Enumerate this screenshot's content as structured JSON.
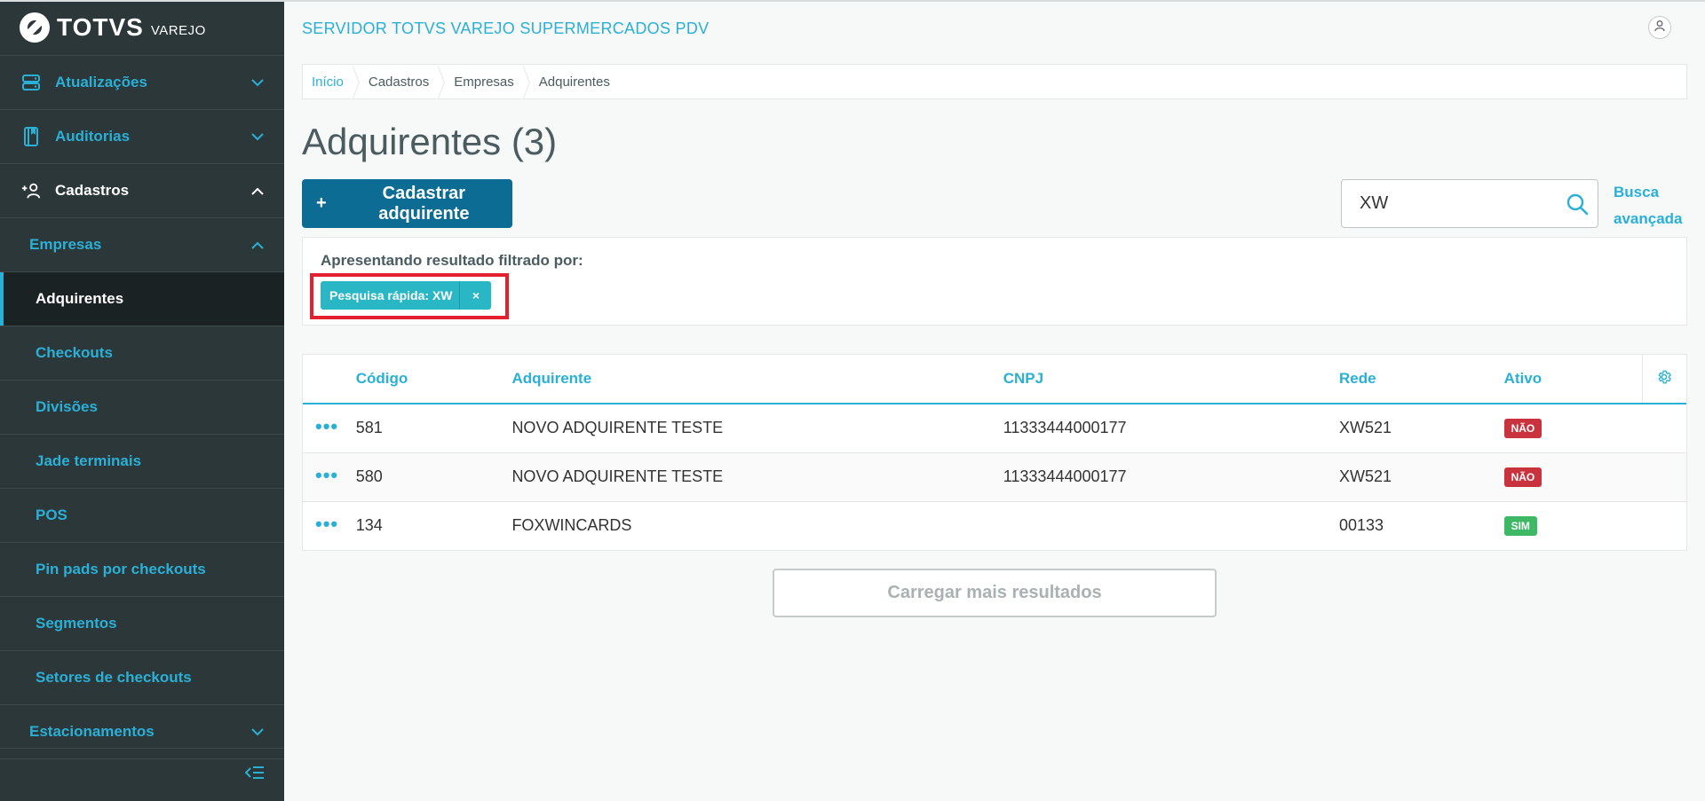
{
  "brand": {
    "name": "TOTVS",
    "sub": "VAREJO"
  },
  "sidebar": {
    "items": [
      {
        "label": "Atualizações",
        "icon": "server-icon",
        "level": 1,
        "state": "collapsed"
      },
      {
        "label": "Auditorias",
        "icon": "book-icon",
        "level": 1,
        "state": "collapsed"
      },
      {
        "label": "Cadastros",
        "icon": "add-user-icon",
        "level": 1,
        "state": "expanded"
      },
      {
        "label": "Empresas",
        "level": 2,
        "state": "expanded"
      },
      {
        "label": "Adquirentes",
        "level": 3,
        "active": true
      },
      {
        "label": "Checkouts",
        "level": 3
      },
      {
        "label": "Divisões",
        "level": 3
      },
      {
        "label": "Jade terminais",
        "level": 3
      },
      {
        "label": "POS",
        "level": 3
      },
      {
        "label": "Pin pads por checkouts",
        "level": 3
      },
      {
        "label": "Segmentos",
        "level": 3
      },
      {
        "label": "Setores de checkouts",
        "level": 3
      },
      {
        "label": "Estacionamentos",
        "level": 2,
        "state": "collapsed"
      }
    ]
  },
  "header": {
    "app_title": "SERVIDOR TOTVS VAREJO SUPERMERCADOS PDV"
  },
  "breadcrumb": [
    "Início",
    "Cadastros",
    "Empresas",
    "Adquirentes"
  ],
  "page": {
    "title": "Adquirentes (3)",
    "primary_button": "Cadastrar adquirente",
    "search_value": "XW",
    "advanced_search_line1": "Busca",
    "advanced_search_line2": "avançada"
  },
  "filter": {
    "label": "Apresentando resultado filtrado por:",
    "chip": "Pesquisa rápida: XW",
    "close_symbol": "×"
  },
  "table": {
    "columns": [
      "Código",
      "Adquirente",
      "CNPJ",
      "Rede",
      "Ativo"
    ],
    "rows": [
      {
        "code": "581",
        "name": "NOVO ADQUIRENTE TESTE",
        "cnpj": "11333444000177",
        "rede": "XW521",
        "ativo": "NÃO"
      },
      {
        "code": "580",
        "name": "NOVO ADQUIRENTE TESTE",
        "cnpj": "11333444000177",
        "rede": "XW521",
        "ativo": "NÃO"
      },
      {
        "code": "134",
        "name": "FOXWINCARDS",
        "cnpj": "",
        "rede": "00133",
        "ativo": "SIM"
      }
    ],
    "actions_symbol": "•••"
  },
  "load_more": "Carregar mais resultados",
  "colors": {
    "sidebar_bg": "#2c3739",
    "accent": "#2ab0d6",
    "primary": "#0c6c94",
    "chip": "#29b6c5",
    "badge_no": "#c9333d",
    "badge_yes": "#3fb866",
    "highlight": "#e5202e"
  }
}
